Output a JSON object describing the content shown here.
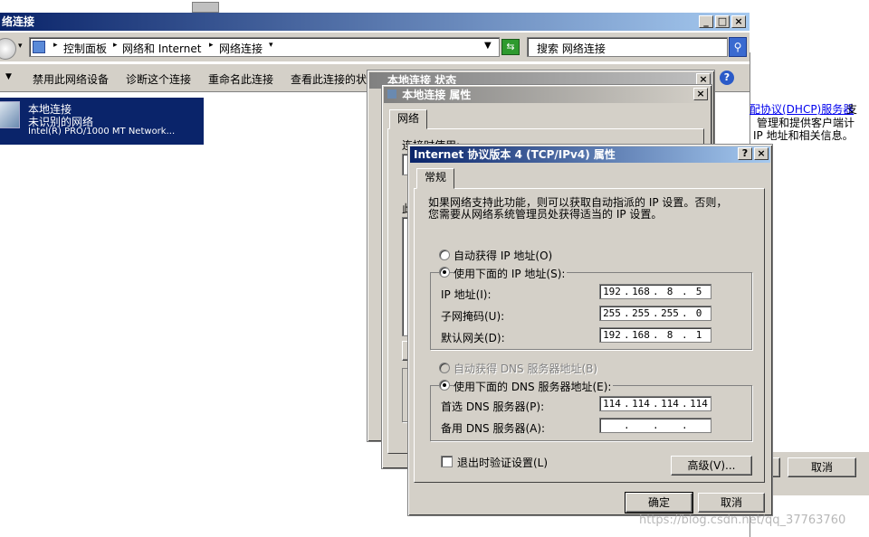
{
  "explorer": {
    "title": "络连接",
    "breadcrumb": [
      "控制面板",
      "网络和 Internet",
      "网络连接"
    ],
    "search_placeholder": "搜索 网络连接",
    "toolbar": [
      "禁用此网络设备",
      "诊断这个连接",
      "重命名此连接",
      "查看此连接的状"
    ],
    "connection": {
      "name": "本地连接",
      "status": "未识别的网络",
      "adapter": "Intel(R) PRO/1000 MT Network..."
    },
    "right_pane": {
      "link": "配协议(DHCP)服务器",
      "line1_suffix": "支",
      "line2": "管理和提供客户端计",
      "line3": "IP 地址和相关信息。"
    },
    "cancel_label": "取消"
  },
  "status_dialog": {
    "title": "本地连接 状态"
  },
  "props_dialog": {
    "title": "本地连接 属性",
    "tab": "网络",
    "label_connect": "连接时使用:",
    "label_this": "此"
  },
  "ipv4_dialog": {
    "title": "Internet 协议版本 4 (TCP/IPv4) 属性",
    "tab": "常规",
    "description": "如果网络支持此功能，则可以获取自动指派的 IP 设置。否则，您需要从网络系统管理员处获得适当的 IP 设置。",
    "auto_ip": "自动获得 IP 地址(O)",
    "manual_ip": "使用下面的 IP 地址(S):",
    "ip_label": "IP 地址(I):",
    "mask_label": "子网掩码(U):",
    "gateway_label": "默认网关(D):",
    "ip": [
      "192",
      "168",
      "8",
      "5"
    ],
    "mask": [
      "255",
      "255",
      "255",
      "0"
    ],
    "gateway": [
      "192",
      "168",
      "8",
      "1"
    ],
    "auto_dns": "自动获得 DNS 服务器地址(B)",
    "manual_dns": "使用下面的 DNS 服务器地址(E):",
    "dns1_label": "首选 DNS 服务器(P):",
    "dns2_label": "备用 DNS 服务器(A):",
    "dns1": [
      "114",
      "114",
      "114",
      "114"
    ],
    "dns2": [
      "",
      "",
      "",
      ""
    ],
    "validate": "退出时验证设置(L)",
    "advanced": "高级(V)...",
    "ok": "确定",
    "cancel": "取消"
  },
  "watermark": "https://blog.csdn.net/qq_37763760",
  "colors": {
    "title_active": "#0a246a",
    "selection": "#0a246a",
    "dialog_face": "#d4d0c8",
    "link": "#0000ee"
  }
}
